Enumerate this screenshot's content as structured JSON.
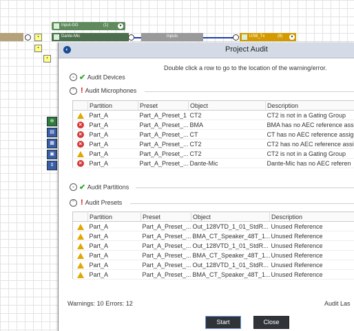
{
  "canvas": {
    "input_gg": {
      "label": "Input-GG",
      "count": "(1)"
    },
    "dante_mic": {
      "label": "Dante-Mic"
    },
    "inputs": {
      "label": "Inputs"
    },
    "usb_tx": {
      "label": "USB_Tx",
      "count": "(8)"
    }
  },
  "dialog": {
    "title": "Project Audit",
    "instruction": "Double click a row to go to the location of the warning/error."
  },
  "sections": {
    "devices": {
      "label": "Audit Devices"
    },
    "microphones": {
      "label": "Audit Microphones"
    },
    "partitions": {
      "label": "Audit Partitions"
    },
    "presets": {
      "label": "Audit Presets"
    }
  },
  "microphones_table": {
    "columns": [
      "Partition",
      "Preset",
      "Object",
      "Description"
    ],
    "rows": [
      {
        "severity": "warning",
        "partition": "Part_A",
        "preset": "Part_A_Preset_1",
        "object": "CT2",
        "description": "CT2 is not in a Gating Group"
      },
      {
        "severity": "error",
        "partition": "Part_A",
        "preset": "Part_A_Preset_...",
        "object": "BMA",
        "description": "BMA has no AEC reference ass"
      },
      {
        "severity": "error",
        "partition": "Part_A",
        "preset": "Part_A_Preset_...",
        "object": "CT",
        "description": "CT has no AEC reference assig"
      },
      {
        "severity": "error",
        "partition": "Part_A",
        "preset": "Part_A_Preset_...",
        "object": "CT2",
        "description": "CT2 has no AEC reference assi"
      },
      {
        "severity": "warning",
        "partition": "Part_A",
        "preset": "Part_A_Preset_...",
        "object": "CT2",
        "description": "CT2 is not in a Gating Group"
      },
      {
        "severity": "error",
        "partition": "Part_A",
        "preset": "Part_A_Preset_...",
        "object": "Dante-Mic",
        "description": "Dante-Mic has no AEC referen"
      }
    ]
  },
  "presets_table": {
    "columns": [
      "Partition",
      "Preset",
      "Object",
      "Description"
    ],
    "rows": [
      {
        "severity": "warning",
        "partition": "Part_A",
        "preset": "Part_A_Preset_...",
        "object": "Out_128VTD_1_01_StdR...",
        "description": "Unused Reference"
      },
      {
        "severity": "warning",
        "partition": "Part_A",
        "preset": "Part_A_Preset_...",
        "object": "BMA_CT_Speaker_48T_1...",
        "description": "Unused Reference"
      },
      {
        "severity": "warning",
        "partition": "Part_A",
        "preset": "Part_A_Preset_...",
        "object": "Out_128VTD_1_01_StdR...",
        "description": "Unused Reference"
      },
      {
        "severity": "warning",
        "partition": "Part_A",
        "preset": "Part_A_Preset_...",
        "object": "BMA_CT_Speaker_48T_1...",
        "description": "Unused Reference"
      },
      {
        "severity": "warning",
        "partition": "Part_A",
        "preset": "Part_A_Preset_...",
        "object": "Out_128VTD_1_01_StdR...",
        "description": "Unused Reference"
      },
      {
        "severity": "warning",
        "partition": "Part_A",
        "preset": "Part_A_Preset_...",
        "object": "BMA_CT_Speaker_48T_1...",
        "description": "Unused Reference"
      }
    ]
  },
  "footer": {
    "stats": "Warnings: 10   Errors: 12",
    "audit_last": "Audit Las",
    "start_label": "Start",
    "close_label": "Close"
  },
  "colors": {
    "warning": "#e0a800",
    "error": "#d63939",
    "ok": "#2aa82a",
    "titlebar": "#d4dbe6",
    "button": "#30343a"
  }
}
